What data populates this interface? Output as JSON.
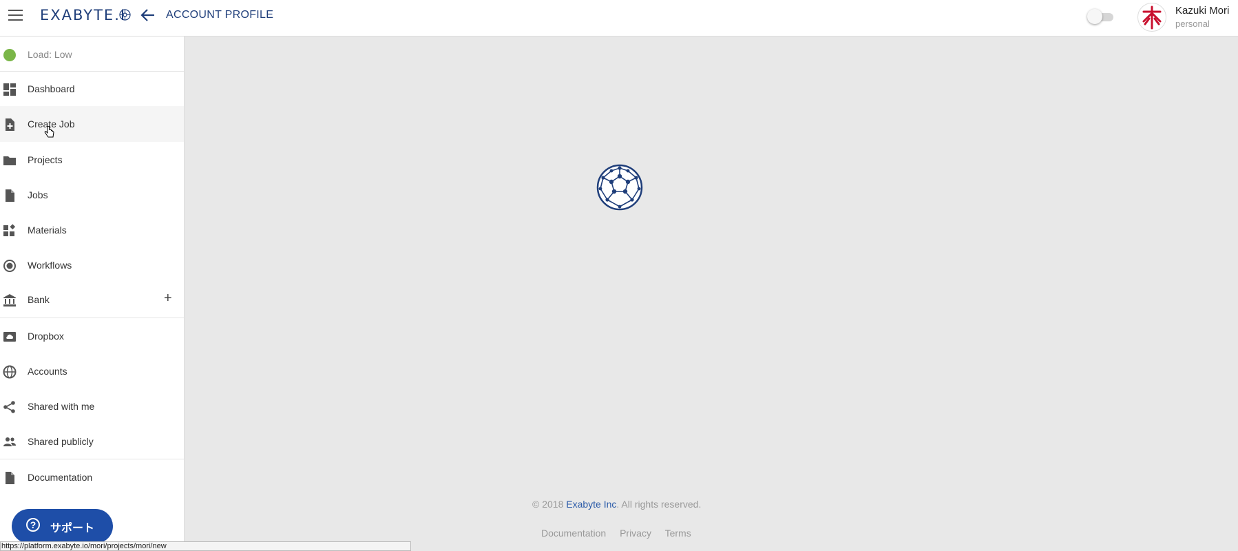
{
  "header": {
    "logo_text": "EXABYTE.I",
    "page_title": "ACCOUNT PROFILE",
    "user_name": "Kazuki Mori",
    "user_type": "personal"
  },
  "sidebar": {
    "load_label": "Load: Low",
    "items": [
      {
        "label": "Dashboard",
        "icon": "dashboard-icon"
      },
      {
        "label": "Create Job",
        "icon": "file-plus-icon"
      },
      {
        "label": "Projects",
        "icon": "folder-icon"
      },
      {
        "label": "Jobs",
        "icon": "file-icon"
      },
      {
        "label": "Materials",
        "icon": "widgets-icon"
      },
      {
        "label": "Workflows",
        "icon": "radio-icon"
      },
      {
        "label": "Bank",
        "icon": "bank-icon"
      },
      {
        "label": "Dropbox",
        "icon": "cloud-box-icon"
      },
      {
        "label": "Accounts",
        "icon": "globe-icon"
      },
      {
        "label": "Shared with me",
        "icon": "share-icon"
      },
      {
        "label": "Shared publicly",
        "icon": "people-icon"
      },
      {
        "label": "Documentation",
        "icon": "document-icon"
      }
    ],
    "bank_add": "+",
    "support_label": "サポート"
  },
  "footer": {
    "copyright_prefix": "© 2018 ",
    "company": "Exabyte Inc",
    "copyright_suffix": ". All rights reserved.",
    "links": [
      "Documentation",
      "Privacy",
      "Terms"
    ]
  },
  "status_bar": {
    "url": "https://platform.exabyte.io/mori/projects/mori/new"
  },
  "colors": {
    "brand": "#1f3e7a",
    "load_low": "#7ab648",
    "support": "#1e4ea8"
  }
}
